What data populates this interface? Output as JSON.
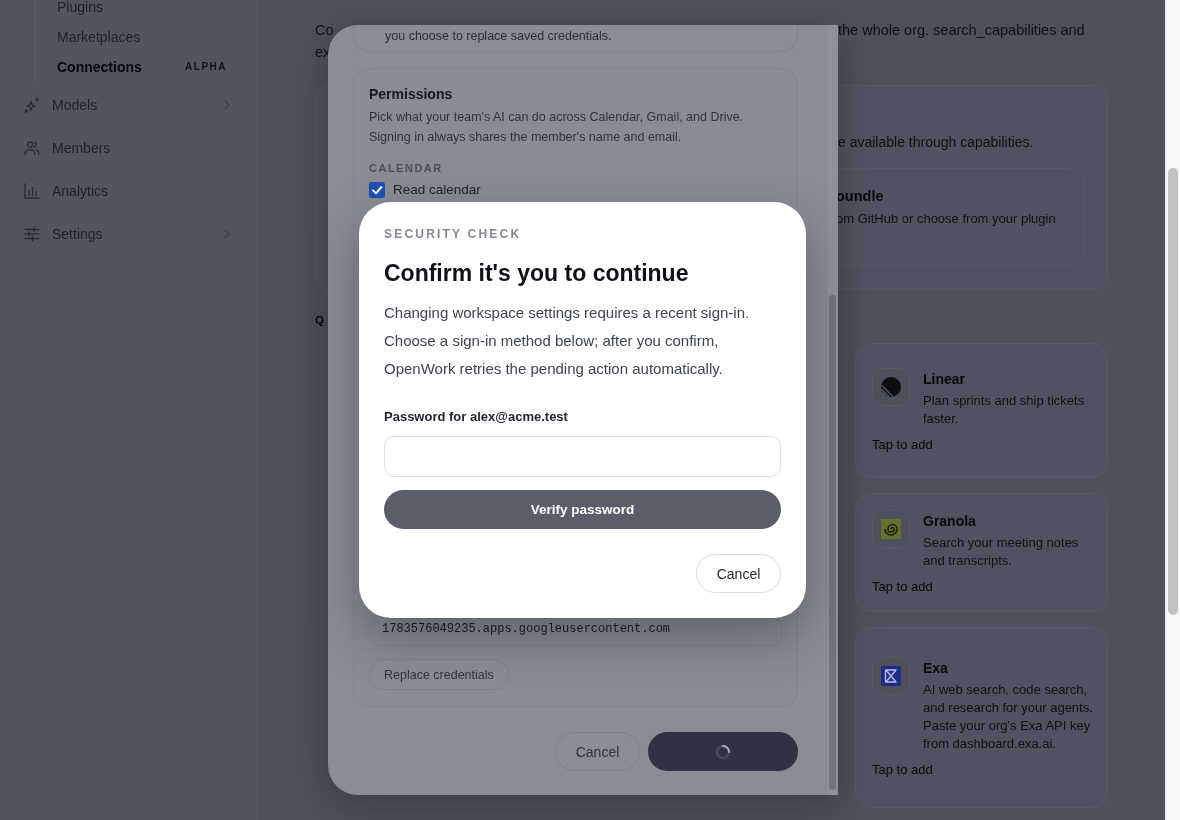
{
  "sidebar": {
    "sub_items": [
      {
        "label": "Plugins",
        "selected": false
      },
      {
        "label": "Marketplaces",
        "selected": false
      },
      {
        "label": "Connections",
        "selected": true,
        "tag": "ALPHA"
      }
    ],
    "items": [
      {
        "label": "Models",
        "has_submenu": true
      },
      {
        "label": "Members",
        "has_submenu": false
      },
      {
        "label": "Analytics",
        "has_submenu": false
      },
      {
        "label": "Settings",
        "has_submenu": true
      }
    ]
  },
  "main": {
    "intro": {
      "line_1_start": "Co",
      "line_1_end": "the whole org. search_capabilities and",
      "line_2_start": "ex"
    },
    "capabilities_card": {
      "text_fragment": "e available through capabilities.",
      "option": {
        "title_fragment": "oundle",
        "description_fragment": "om GitHub or choose from your plugin"
      }
    },
    "section_label_fragment": "Q",
    "connectors": [
      {
        "name": "Linear",
        "description": "Plan sprints and ship tickets faster.",
        "action": "Tap to add"
      },
      {
        "name": "Granola",
        "description": "Search your meeting notes and transcripts.",
        "action": "Tap to add"
      },
      {
        "name": "Exa",
        "description": "AI web search, code search, and research for your agents. Paste your org's Exa API key from dashboard.exa.ai.",
        "action": "Tap to add"
      }
    ]
  },
  "connection_modal": {
    "top_card_text": "you choose to replace saved credentials.",
    "permissions": {
      "title": "Permissions",
      "description": "Pick what your team's AI can do across Calendar, Gmail, and Drive. Signing in always shares the member's name and email.",
      "groups": [
        {
          "label": "CALENDAR",
          "options": [
            {
              "label": "Read calendar",
              "checked": true
            }
          ]
        }
      ],
      "client_id_value": "1783576049235.apps.googleusercontent.com",
      "replace_button": "Replace credentials"
    },
    "footer_buttons": [
      {
        "kind": "secondary",
        "label": "Cancel"
      },
      {
        "kind": "primary",
        "loading": true
      }
    ]
  },
  "security_dialog": {
    "eyebrow": "SECURITY CHECK",
    "title": "Confirm it's you to continue",
    "message": "Changing workspace settings requires a recent sign-in. Choose a sign-in method below; after you confirm, OpenWork retries the pending action automatically.",
    "password_label": "Password for alex@acme.test",
    "verify_button": {
      "label": "Verify password",
      "disabled": true
    },
    "cancel_button": "Cancel"
  }
}
